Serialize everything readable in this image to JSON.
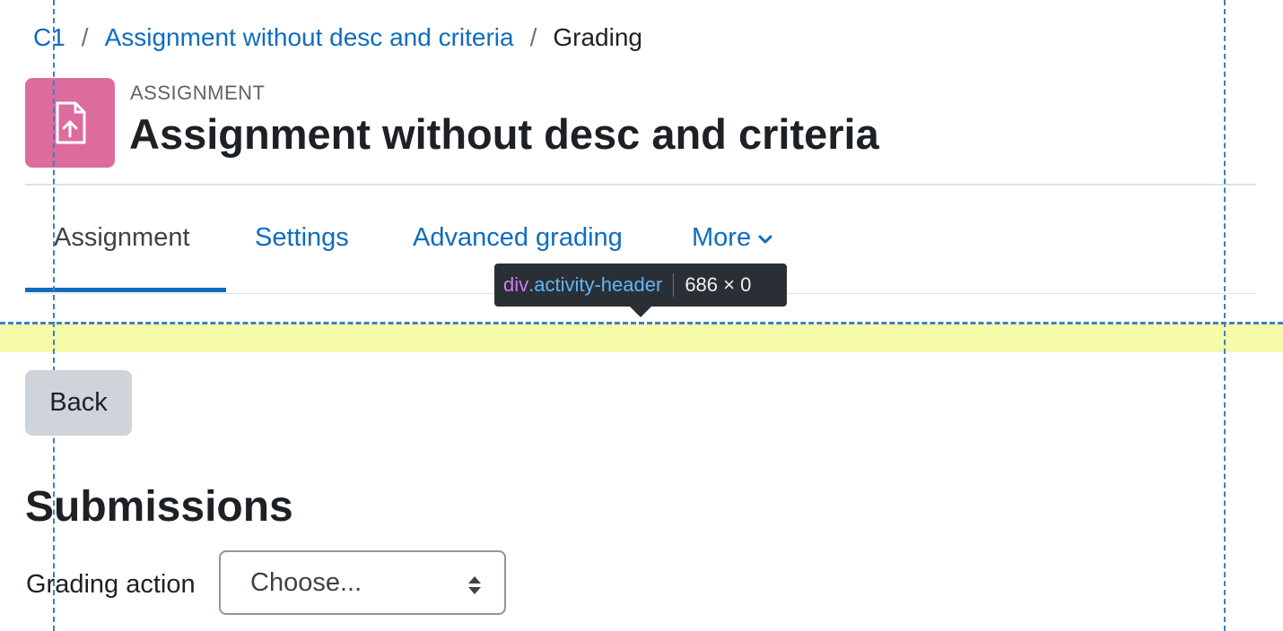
{
  "breadcrumb": {
    "items": [
      "C1",
      "Assignment without desc and criteria"
    ],
    "separator": "/",
    "current": "Grading"
  },
  "header": {
    "activity_type": "ASSIGNMENT",
    "title": "Assignment without desc and criteria",
    "icon": "file-upload-icon",
    "icon_color": "#dc6c9d"
  },
  "tabs": [
    {
      "label": "Assignment",
      "active": true
    },
    {
      "label": "Settings",
      "active": false
    },
    {
      "label": "Advanced grading",
      "active": false
    },
    {
      "label": "More",
      "active": false,
      "icon": "chevron-down-icon"
    }
  ],
  "devtools_tooltip": {
    "tag": "div",
    "class_name": ".activity-header",
    "dimensions": "686 × 0"
  },
  "actions": {
    "back_label": "Back"
  },
  "submissions": {
    "heading": "Submissions",
    "grading_action_label": "Grading action",
    "grading_action_value": "Choose..."
  },
  "colors": {
    "link": "#0f6cbf",
    "highlight": "#f6fbaa",
    "guide": "#3b7fc4"
  }
}
